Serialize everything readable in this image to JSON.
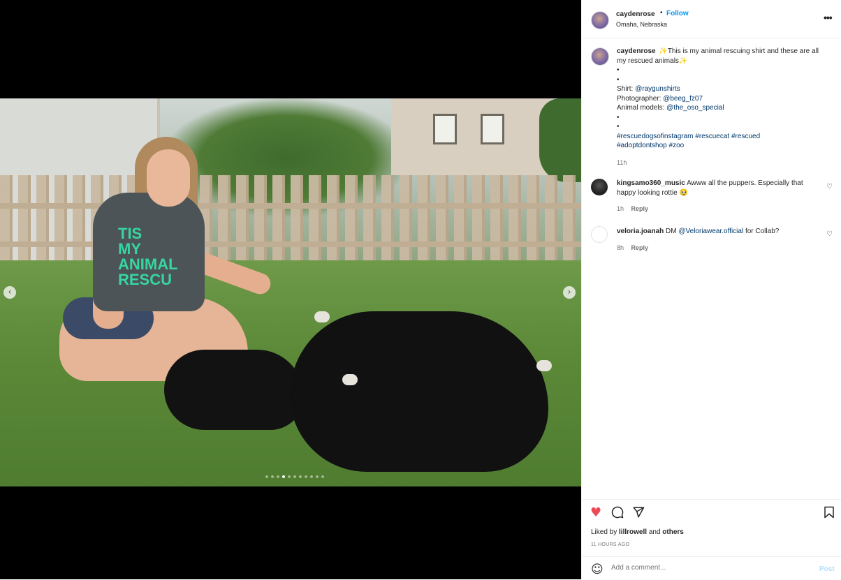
{
  "post": {
    "username": "caydenrose",
    "separator": "•",
    "follow_label": "Follow",
    "location": "Omaha, Nebraska",
    "more_icon": "more-horizontal-icon",
    "carousel": {
      "slide_count": 11,
      "active_index": 3
    }
  },
  "caption": {
    "username": "caydenrose",
    "sparkle": "✨",
    "text": "This is my animal rescuing shirt and these are all my rescued animals",
    "bullet": "•",
    "shirt_label": "Shirt:",
    "shirt_tag": "@raygunshirts",
    "photographer_label": "Photographer:",
    "photographer_tag": "@beeg_fz07",
    "models_label": "Animal models:",
    "models_tag": "@the_oso_special",
    "hashtag1": "#rescuedogsofinstagram",
    "hashtag2": "#rescuecat",
    "hashtag3": "#rescued",
    "hashtag4": "#adoptdontshop",
    "hashtag5": "#zoo",
    "time": "11h"
  },
  "comments": [
    {
      "username": "kingsamo360_music",
      "text": "Awww all the puppers. Especially that happy looking rottie 🥹",
      "time": "1h",
      "reply_label": "Reply"
    },
    {
      "username": "veloria.joanah",
      "prefix": "DM",
      "mention": "@Veloriawear.official",
      "suffix": "for Collab?",
      "time": "8h",
      "reply_label": "Reply"
    }
  ],
  "actions": {
    "liked_by_prefix": "Liked by",
    "liked_by_user": "lillrowell",
    "liked_by_and": "and",
    "liked_by_others": "others",
    "timestamp": "11 HOURS AGO",
    "like_color": "#ed4956"
  },
  "add_comment": {
    "placeholder": "Add a comment...",
    "post_label": "Post"
  }
}
